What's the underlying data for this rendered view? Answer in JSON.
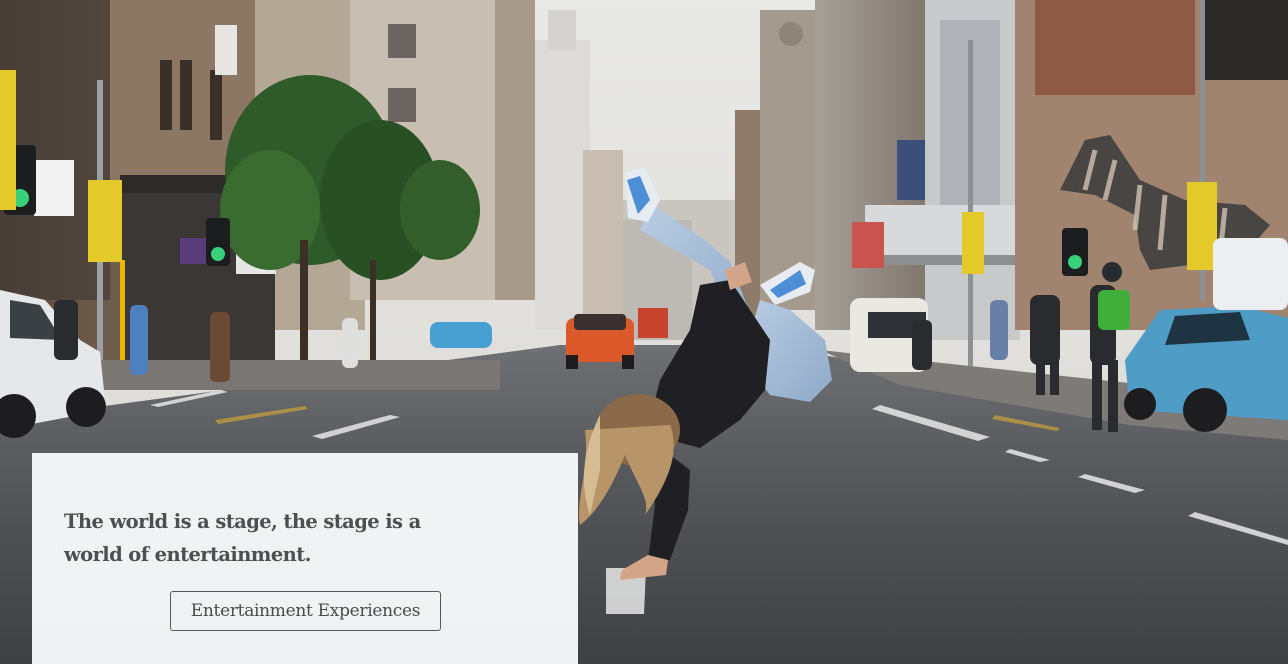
{
  "hero": {
    "image_alt": "Breakdancer doing a one-handed freeze in the middle of a city street",
    "tagline": "The world is a stage, the stage is a world of entertainment.",
    "cta_label": "Entertainment Experiences"
  },
  "colors": {
    "card_background": "#f8f9fa",
    "text": "#4e4f52",
    "button_border": "#55575a"
  }
}
